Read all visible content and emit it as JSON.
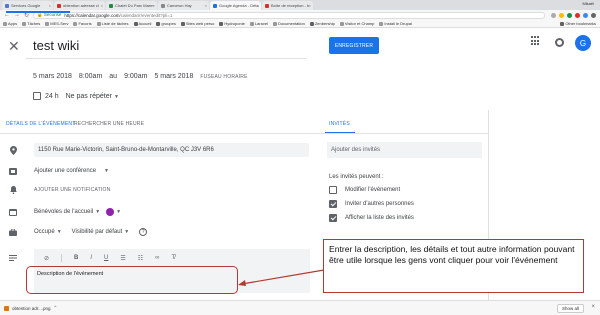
{
  "browser": {
    "tabs": [
      {
        "label": "Services Google"
      },
      {
        "label": "obtention adresse cl"
      },
      {
        "label": "Chalet Du Parc Marm"
      },
      {
        "label": "Cameron Hay"
      },
      {
        "label": "Google Agenda - Déta"
      },
      {
        "label": "Boîte de réception - b"
      }
    ],
    "user": "Mikaël",
    "secure_label": "Sécurisé",
    "url_main": "https://calendar.google.com",
    "url_rest": "/calendar/r/eventedit?pli=1",
    "bookmarks": [
      "Apps",
      "Tâches",
      "MES-Serv",
      "Favoris",
      "Liste de tâches",
      "Accueil",
      "groupes",
      "Sites web perso",
      "Hydroponie",
      "Laravel",
      "Documentation",
      "Zenbership",
      "Visitor et Champ",
      "Install le Drupal"
    ],
    "other_bookmarks": "Other bookmarks"
  },
  "event": {
    "title": "test wiki",
    "save_label": "ENREGISTRER",
    "start_date": "5 mars 2018",
    "start_time": "8:00am",
    "to_label": "au",
    "end_time": "9:00am",
    "end_date": "5 mars 2018",
    "timezone_label": "FUSEAU HORAIRE",
    "allday_label": "24 h",
    "repeat_value": "Ne pas répéter",
    "avatar_initial": "G"
  },
  "tabs": {
    "details": "DÉTAILS DE L'ÉVÉNEMENT",
    "find_time": "RECHERCHER UNE HEURE",
    "invites": "INVITÉS"
  },
  "details": {
    "location": "1150 Rue Marie-Victorin, Saint-Bruno-de-Montarville, QC J3V 6R6",
    "conference": "Ajouter une conférence",
    "notification": "AJOUTER UNE NOTIFICATION",
    "calendar": "Bénévoles de l'accueil",
    "calendar_color": "#8e24aa",
    "busy": "Occupé",
    "visibility": "Visibilité par défaut",
    "description_placeholder": "Description de l'événement"
  },
  "invites": {
    "add_placeholder": "Ajouter des invités",
    "guests_can": "Les invités peuvent :",
    "permissions": [
      {
        "label": "Modifier l'événement",
        "checked": false
      },
      {
        "label": "Inviter d'autres personnes",
        "checked": true
      },
      {
        "label": "Afficher la liste des invités",
        "checked": true
      }
    ]
  },
  "callout": {
    "text": "Entrer la description, les détails et tout autre information pouvant être utile lorsque les gens vont cliquer pour voir l'événement"
  },
  "downloads": {
    "file": "obtention adr....png",
    "show_all": "Show all"
  }
}
